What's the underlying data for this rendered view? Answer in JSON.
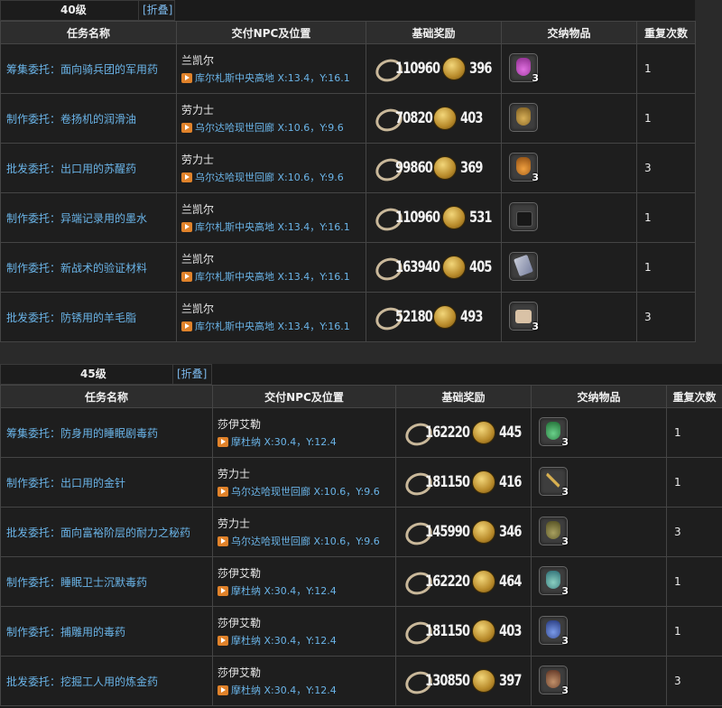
{
  "header": {
    "columns": [
      "任务名称",
      "交付NPC及位置",
      "基础奖励",
      "交纳物品",
      "重复次数"
    ],
    "toggle": "[折叠]"
  },
  "colors": {
    "link": "#6ab4e8",
    "marker": "#e0822a"
  },
  "sections": [
    {
      "level": "40级",
      "quests": [
        {
          "name": "筹集委托：面向骑兵团的军用药",
          "npc": "兰凯尔",
          "location": "库尔札斯中央高地 X:13.4，Y:16.1",
          "xp": "110960",
          "gil": "396",
          "item": "purple-potion-icon",
          "count": "3",
          "repeat": "1"
        },
        {
          "name": "制作委托：卷扬机的润滑油",
          "npc": "劳力士",
          "location": "乌尔达哈现世回廊 X:10.6，Y:9.6",
          "xp": "70820",
          "gil": "403",
          "item": "oil-jug-icon",
          "count": "",
          "repeat": "1"
        },
        {
          "name": "批发委托：出口用的苏醒药",
          "npc": "劳力士",
          "location": "乌尔达哈现世回廊 X:10.6，Y:9.6",
          "xp": "99860",
          "gil": "369",
          "item": "orange-potion-icon",
          "count": "3",
          "repeat": "3"
        },
        {
          "name": "制作委托：异端记录用的墨水",
          "npc": "兰凯尔",
          "location": "库尔札斯中央高地 X:13.4，Y:16.1",
          "xp": "110960",
          "gil": "531",
          "item": "ink-bottle-icon",
          "count": "",
          "repeat": "1"
        },
        {
          "name": "制作委托：新战术的验证材料",
          "npc": "兰凯尔",
          "location": "库尔札斯中央高地 X:13.4，Y:16.1",
          "xp": "163940",
          "gil": "405",
          "item": "paper-icon",
          "count": "",
          "repeat": "1"
        },
        {
          "name": "批发委托：防锈用的羊毛脂",
          "npc": "兰凯尔",
          "location": "库尔札斯中央高地 X:13.4，Y:16.1",
          "xp": "52180",
          "gil": "493",
          "item": "lanolin-block-icon",
          "count": "3",
          "repeat": "3"
        }
      ]
    },
    {
      "level": "45级",
      "quests": [
        {
          "name": "筹集委托：防身用的睡眠剧毒药",
          "npc": "莎伊艾勒",
          "location": "摩杜纳 X:30.4，Y:12.4",
          "xp": "162220",
          "gil": "445",
          "item": "green-potion-icon",
          "count": "3",
          "repeat": "1"
        },
        {
          "name": "制作委托：出口用的金针",
          "npc": "劳力士",
          "location": "乌尔达哈现世回廊 X:10.6，Y:9.6",
          "xp": "181150",
          "gil": "416",
          "item": "gold-needle-icon",
          "count": "3",
          "repeat": "1"
        },
        {
          "name": "批发委托：面向富裕阶层的耐力之秘药",
          "npc": "劳力士",
          "location": "乌尔达哈现世回廊 X:10.6，Y:9.6",
          "xp": "145990",
          "gil": "346",
          "item": "olive-flasks-icon",
          "count": "3",
          "repeat": "3"
        },
        {
          "name": "制作委托：睡眠卫士沉默毒药",
          "npc": "莎伊艾勒",
          "location": "摩杜纳 X:30.4，Y:12.4",
          "xp": "162220",
          "gil": "464",
          "item": "teal-potion-icon",
          "count": "3",
          "repeat": "1"
        },
        {
          "name": "制作委托：捕雕用的毒药",
          "npc": "莎伊艾勒",
          "location": "摩杜纳 X:30.4，Y:12.4",
          "xp": "181150",
          "gil": "403",
          "item": "blue-potion-icon",
          "count": "3",
          "repeat": "1"
        },
        {
          "name": "批发委托：挖掘工人用的炼金药",
          "npc": "莎伊艾勒",
          "location": "摩杜纳 X:30.4，Y:12.4",
          "xp": "130850",
          "gil": "397",
          "item": "brown-potion-icon",
          "count": "3",
          "repeat": "3"
        }
      ]
    }
  ]
}
